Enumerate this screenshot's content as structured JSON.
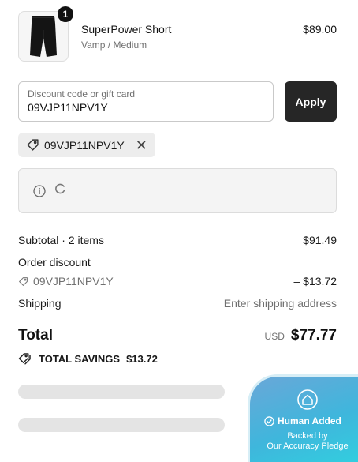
{
  "product": {
    "name": "SuperPower Short",
    "variant": "Vamp / Medium",
    "price": "$89.00",
    "quantity": "1"
  },
  "discount": {
    "label": "Discount code or gift card",
    "value": "09VJP11NPV1Y",
    "apply_label": "Apply",
    "applied_code": "09VJP11NPV1Y"
  },
  "summary": {
    "subtotal_label": "Subtotal · 2 items",
    "subtotal_value": "$91.49",
    "order_discount_label": "Order discount",
    "discount_code": "09VJP11NPV1Y",
    "discount_value": "– $13.72",
    "shipping_label": "Shipping",
    "shipping_value": "Enter shipping address"
  },
  "total": {
    "label": "Total",
    "currency": "USD",
    "amount": "$77.77",
    "savings_label": "TOTAL SAVINGS",
    "savings_value": "$13.72"
  },
  "trust_badge": {
    "title": "Human Added",
    "subtitle_line1": "Backed by",
    "subtitle_line2": "Our Accuracy Pledge"
  },
  "colors": {
    "apply_button": "#262626",
    "badge_gradient_start": "#6aa7d8",
    "badge_gradient_end": "#2ed5e0"
  },
  "icons": {
    "thumbnail": "shorts-product-image",
    "chip": "tag-icon",
    "remove": "close-icon",
    "info": "info-icon",
    "loading": "spinner-icon",
    "savings": "tags-icon",
    "badge": "house-shield-icon",
    "badge_check": "check-circle-icon"
  }
}
